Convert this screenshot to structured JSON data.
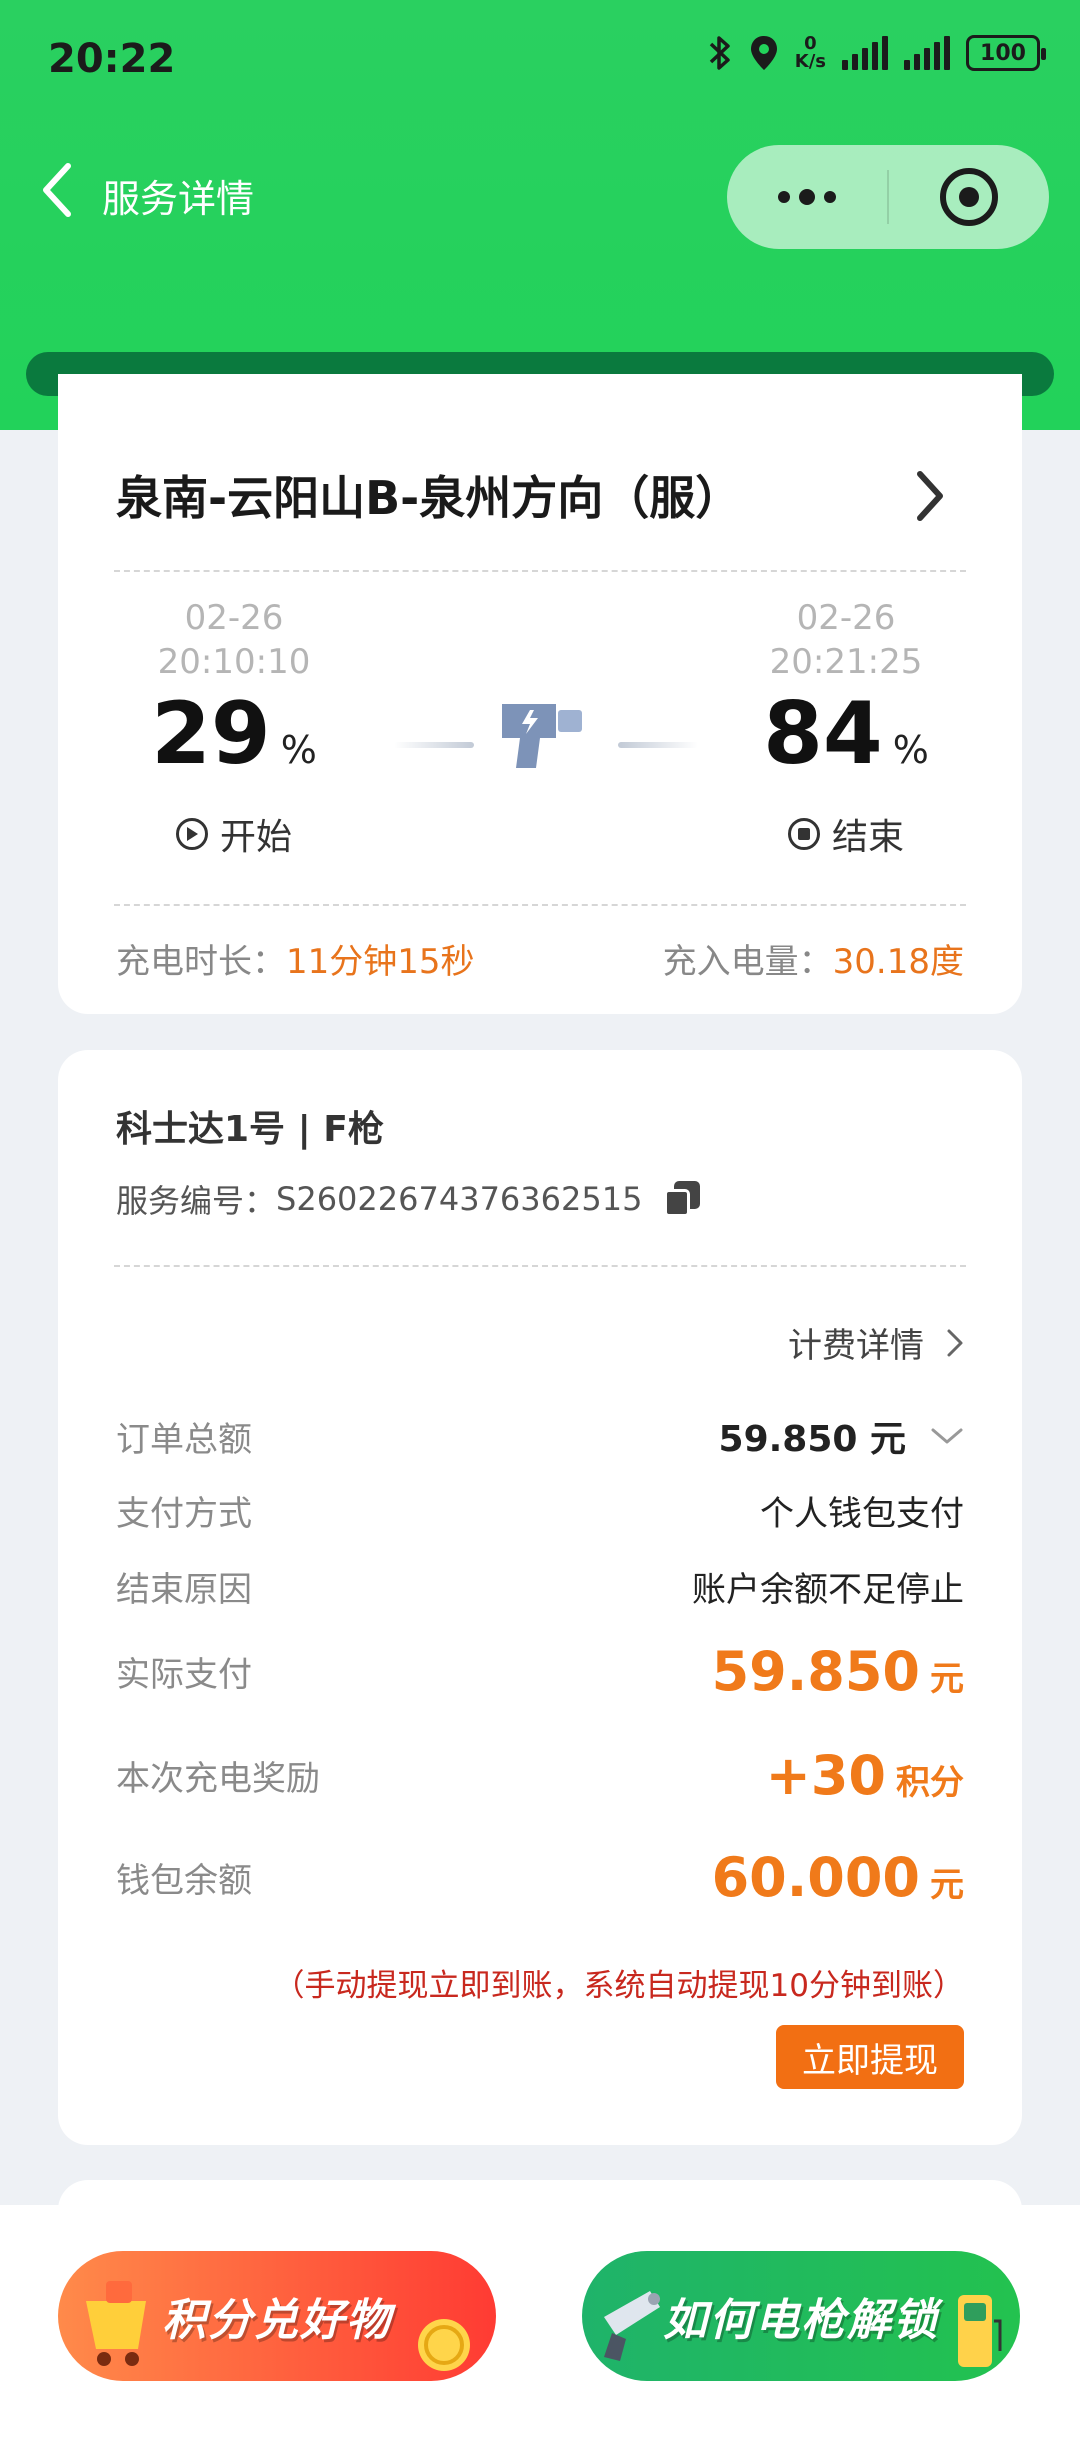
{
  "status_bar": {
    "time": "20:22",
    "net_speed_value": "0",
    "net_speed_unit": "K/s",
    "battery": "100"
  },
  "nav": {
    "title": "服务详情"
  },
  "station": {
    "name": "泉南-云阳山B-泉州方向（服）",
    "start_date": "02-26",
    "start_time": "20:10:10",
    "start_percent": "29",
    "start_label": "开始",
    "end_date": "02-26",
    "end_time": "20:21:25",
    "end_percent": "84",
    "end_label": "结束",
    "percent_sign": "%",
    "duration_label": "充电时长：",
    "duration_value": "11分钟15秒",
    "energy_label": "充入电量：",
    "energy_value": "30.18度"
  },
  "order": {
    "gun_title": "科士达1号 | F枪",
    "service_no_label": "服务编号：",
    "service_no": "S26022674376362515",
    "fee_details_label": "计费详情",
    "total_label": "订单总额",
    "total_value": "59.850 元",
    "payment_label": "支付方式",
    "payment_value": "个人钱包支付",
    "end_reason_label": "结束原因",
    "end_reason_value": "账户余额不足停止",
    "actual_label": "实际支付",
    "actual_value": "59.850",
    "actual_unit": "元",
    "reward_label": "本次充电奖励",
    "reward_value": "+30",
    "reward_unit": "积分",
    "wallet_label": "钱包余额",
    "wallet_value": "60.000",
    "wallet_unit": "元",
    "withdraw_hint": "（手动提现立即到账，系统自动提现10分钟到账）",
    "withdraw_button": "立即提现"
  },
  "promos": {
    "points_mall": "积分兑好物",
    "unlock_guide": "如何电枪解锁"
  },
  "colors": {
    "brand_green": "#22d25a",
    "accent_orange": "#f07a1a",
    "warning_red": "#c8281e"
  }
}
